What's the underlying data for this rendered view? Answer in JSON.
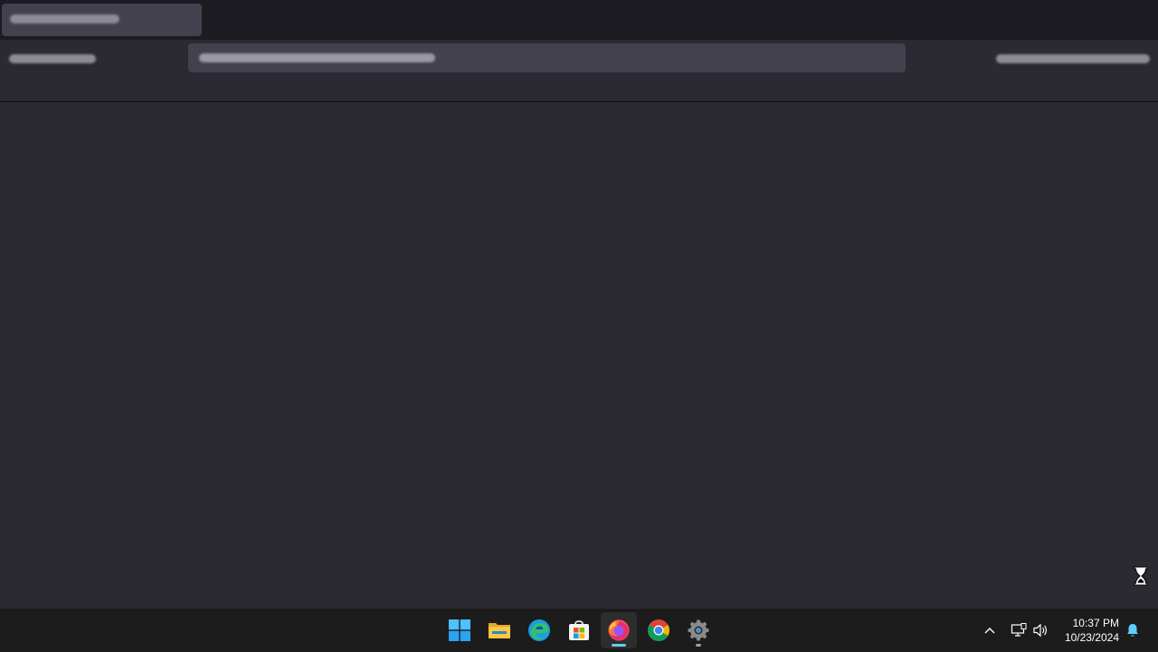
{
  "browser": {
    "accent": "#42414d",
    "tab_placeholder": "",
    "url_placeholder": ""
  },
  "taskbar": {
    "apps": [
      {
        "name": "start-button",
        "icon": "windows-logo-icon"
      },
      {
        "name": "file-explorer",
        "icon": "folder-icon"
      },
      {
        "name": "edge",
        "icon": "edge-icon"
      },
      {
        "name": "microsoft-store",
        "icon": "store-icon"
      },
      {
        "name": "firefox",
        "icon": "firefox-icon",
        "active": true
      },
      {
        "name": "chrome",
        "icon": "chrome-icon"
      },
      {
        "name": "settings",
        "icon": "gear-icon",
        "running": true
      }
    ],
    "tray": {
      "time": "10:37 PM",
      "date": "10/23/2024"
    }
  },
  "colors": {
    "page_bg": "#2b2a33",
    "tabbar_bg": "#1c1b22",
    "taskbar_bg": "#1c1c1c",
    "firefox_indicator": "#60cdff",
    "running_indicator": "#9e9e9e"
  }
}
